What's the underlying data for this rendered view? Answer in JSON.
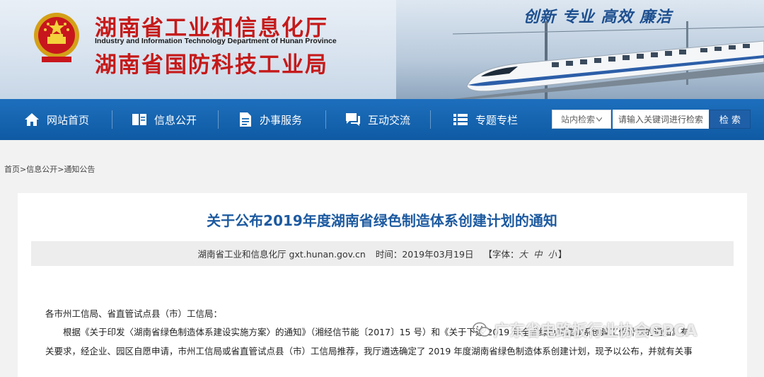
{
  "header": {
    "title_cn": "湖南省工业和信息化厅",
    "title_en": "Industry and Information Technology Department of Hunan Province",
    "subtitle_cn": "湖南省国防科技工业局",
    "slogan": "创新 专业 高效 廉洁",
    "emblem_icon": "national-emblem-icon",
    "brand_red": "#c51a1a"
  },
  "nav": {
    "items": [
      {
        "label": "网站首页",
        "icon": "home-icon"
      },
      {
        "label": "信息公开",
        "icon": "book-icon"
      },
      {
        "label": "办事服务",
        "icon": "document-icon"
      },
      {
        "label": "互动交流",
        "icon": "chat-icon"
      },
      {
        "label": "专题专栏",
        "icon": "list-icon"
      }
    ],
    "background": "#1567b3"
  },
  "search": {
    "scope_label": "站内检索",
    "placeholder": "请输入关键词进行检索",
    "button_label": "检 索"
  },
  "breadcrumb": [
    "首页",
    "信息公开",
    "通知公告"
  ],
  "article": {
    "title": "关于公布2019年度湖南省绿色制造体系创建计划的通知",
    "source": "湖南省工业和信息化厅 gxt.hunan.gov.cn",
    "time": "时间：2019年03月19日",
    "font_label": "【字体：",
    "font_sizes": "大 中 小",
    "font_close": "】",
    "salutation": "各市州工信局、省直管试点县（市）工信局：",
    "para1": "根据《关于印发〈湖南省绿色制造体系建设实施方案〉的通知》（湘经信节能〔2017〕15 号）和《关于下达 2019 年全省绿色制造体系创建工作计划的通知》有",
    "para2": "关要求，经企业、园区自愿申请，市州工信局或省直管试点县（市）工信局推荐，我厅遴选确定了 2019 年度湖南省绿色制造体系创建计划，现予以公布，并就有关事"
  },
  "watermark": {
    "text": "广东省电路板行业协会GPCA",
    "icon": "wechat-icon"
  }
}
